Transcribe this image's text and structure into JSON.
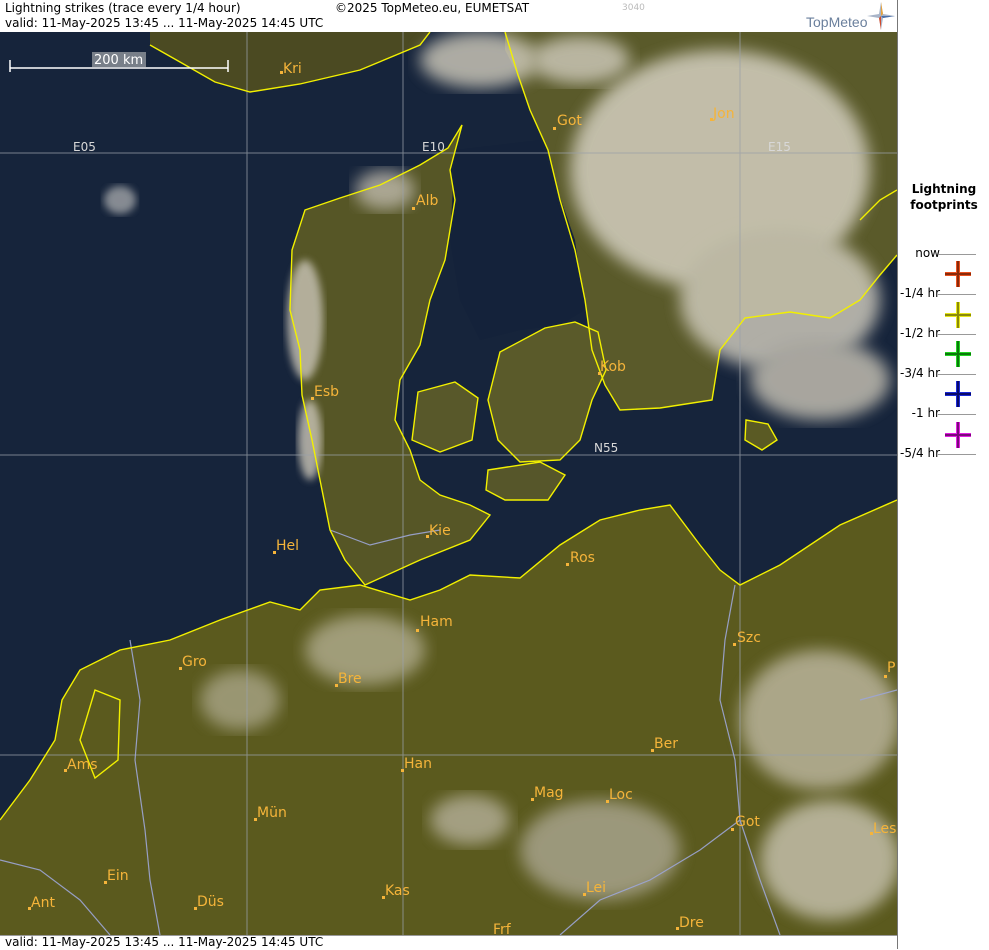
{
  "header": {
    "title": "Lightning strikes (trace every 1/4 hour)",
    "valid": "valid:  11-May-2025 13:45 ... 11-May-2025 14:45 UTC",
    "copyright": "©2025 TopMeteo.eu, EUMETSAT",
    "code": "3040",
    "brand": "TopMeteo"
  },
  "footer": {
    "valid": "valid:  11-May-2025 13:45 ... 11-May-2025 14:45 UTC"
  },
  "map": {
    "scale_label": "200 km",
    "grid_labels": [
      "E05",
      "E10",
      "E15",
      "N55"
    ],
    "cities": [
      "Kri",
      "Got",
      "Jon",
      "Alb",
      "Kob",
      "Esb",
      "Kie",
      "Hel",
      "Ros",
      "Ham",
      "Szc",
      "Gro",
      "Bre",
      "P",
      "Ams",
      "Han",
      "Ber",
      "Mag",
      "Loc",
      "Mün",
      "Got",
      "Les",
      "Ein",
      "Kas",
      "Lei",
      "Ant",
      "Düs",
      "Frf",
      "Dre"
    ],
    "colors": {
      "coastline": "#f2f000",
      "land": "#5b5a1e",
      "sea": "#16243b",
      "cloud": "#d9d4c6",
      "grid": "#9aa0a8",
      "border": "#9da6d6",
      "city": "#f5b43a"
    }
  },
  "legend": {
    "title_line1": "Lightning",
    "title_line2": "footprints",
    "items": [
      {
        "label": "now",
        "color": ""
      },
      {
        "label": "-1/4 hr",
        "color": "#e8501e"
      },
      {
        "label": "-1/2 hr",
        "color": "#e6e61a"
      },
      {
        "label": "-3/4 hr",
        "color": "#22d422"
      },
      {
        "label": "-1 hr",
        "color": "#1a2ad8"
      },
      {
        "label": "-5/4 hr",
        "color": "#e21ee2"
      }
    ]
  }
}
